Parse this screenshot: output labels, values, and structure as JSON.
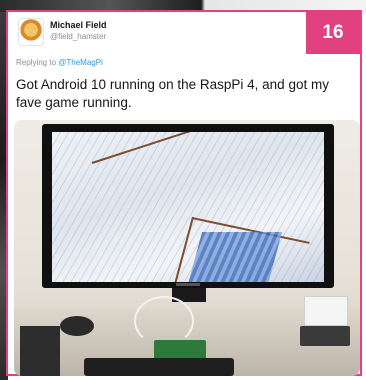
{
  "tweet": {
    "author_name": "Michael Field",
    "author_handle": "@field_hamster",
    "reply_prefix": "Replying to ",
    "reply_mention": "@TheMagPi",
    "text": "Got Android 10 running on the RaspPi 4, and got my fave game running."
  },
  "badge": {
    "number": "16"
  },
  "colors": {
    "accent": "#e2417f",
    "mention": "#2e97de",
    "text": "#14171a",
    "muted": "#8a8f94"
  }
}
